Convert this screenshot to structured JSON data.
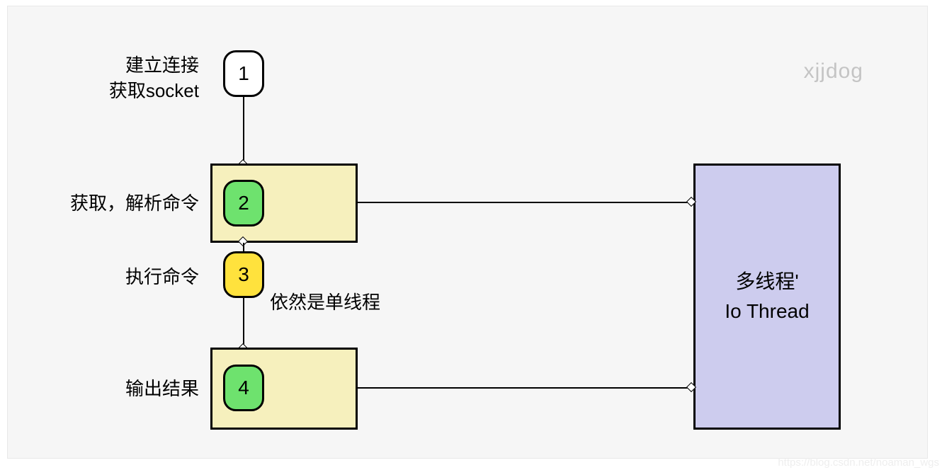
{
  "watermark_top": "xjjdog",
  "watermark_bottom": "https://blog.csdn.net/noaman_wgs",
  "steps": {
    "s1": {
      "num": "1",
      "label_line1": "建立连接",
      "label_line2": "获取socket"
    },
    "s2": {
      "num": "2",
      "label": "获取，解析命令"
    },
    "s3": {
      "num": "3",
      "label": "执行命令",
      "annotation": "依然是单线程"
    },
    "s4": {
      "num": "4",
      "label": "输出结果"
    }
  },
  "right_box": {
    "line1": "多线程'",
    "line2": "Io Thread"
  }
}
